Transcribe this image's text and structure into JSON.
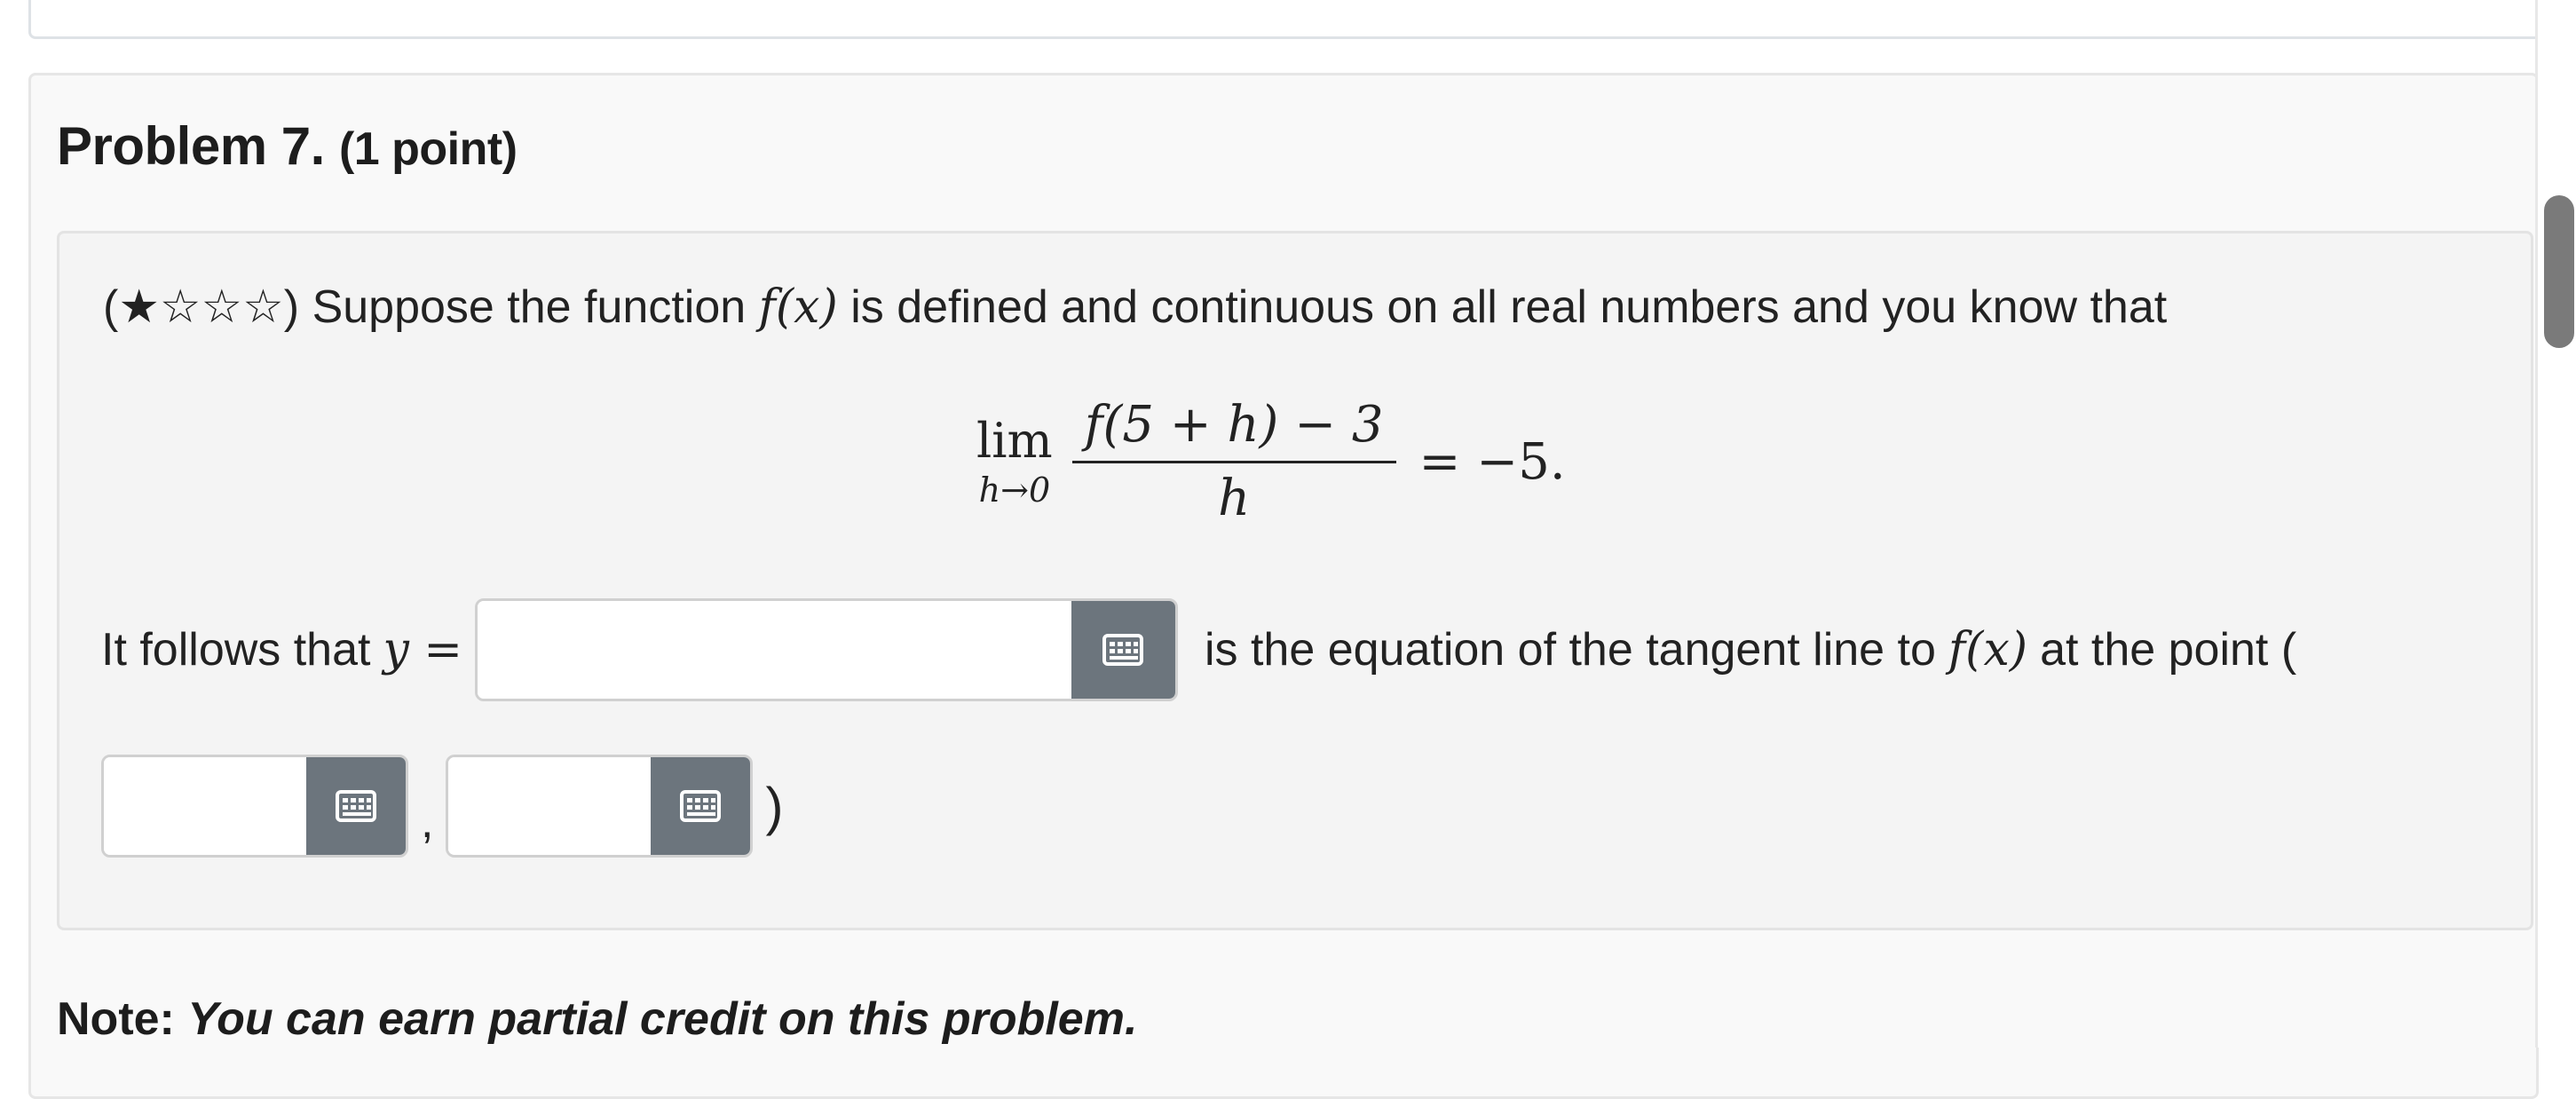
{
  "problem": {
    "title": "Problem 7.",
    "points": "(1 point)"
  },
  "statement": {
    "difficulty_stars": "(★☆☆☆)",
    "text_before_fx": "Suppose the function",
    "func": "f(x)",
    "text_after_fx": "is defined and continuous on all real numbers and you know that"
  },
  "limit": {
    "lim": "lim",
    "subscript": "h→0",
    "numerator": "f(5 + h) − 3",
    "denominator": "h",
    "rhs": "= −5."
  },
  "question": {
    "prefix": "It follows that",
    "y_label": "y =",
    "middle_text": "is the equation of the tangent line to",
    "func": "f(x)",
    "suffix": "at the point (",
    "comma": ",",
    "close": ")"
  },
  "answers": {
    "tangent_line": {
      "value": "",
      "placeholder": ""
    },
    "point_x": {
      "value": "",
      "placeholder": ""
    },
    "point_y": {
      "value": "",
      "placeholder": ""
    }
  },
  "icons": {
    "math_keyboard": "keyboard-icon"
  },
  "note": {
    "label": "Note:",
    "text": "You can earn partial credit on this problem."
  },
  "colors": {
    "keyboard_button": "#6c757d",
    "well_background": "#f4f4f4"
  }
}
